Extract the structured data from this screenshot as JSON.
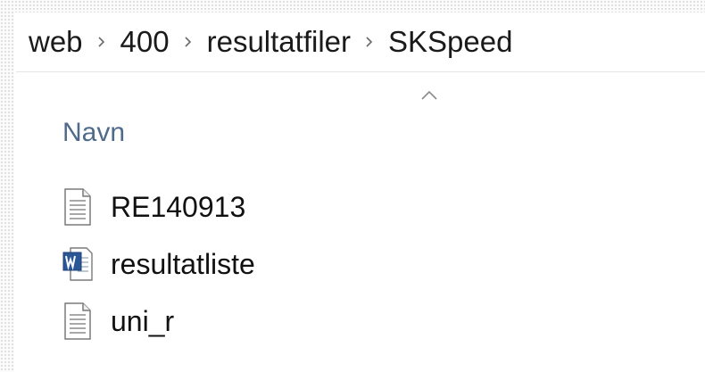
{
  "breadcrumb": {
    "items": [
      {
        "label": "web"
      },
      {
        "label": "400"
      },
      {
        "label": "resultatfiler"
      },
      {
        "label": "SKSpeed"
      }
    ],
    "separator_icon": "chevron-right-icon"
  },
  "columns": {
    "name_header": "Navn",
    "sort_icon": "sort-ascending-icon"
  },
  "files": [
    {
      "name": "RE140913",
      "icon": "text-file-icon"
    },
    {
      "name": "resultatliste",
      "icon": "word-document-icon"
    },
    {
      "name": "uni_r",
      "icon": "text-file-icon"
    }
  ],
  "colors": {
    "header_text": "#4f6a8a",
    "word_blue": "#2b5797",
    "text": "#111111"
  }
}
